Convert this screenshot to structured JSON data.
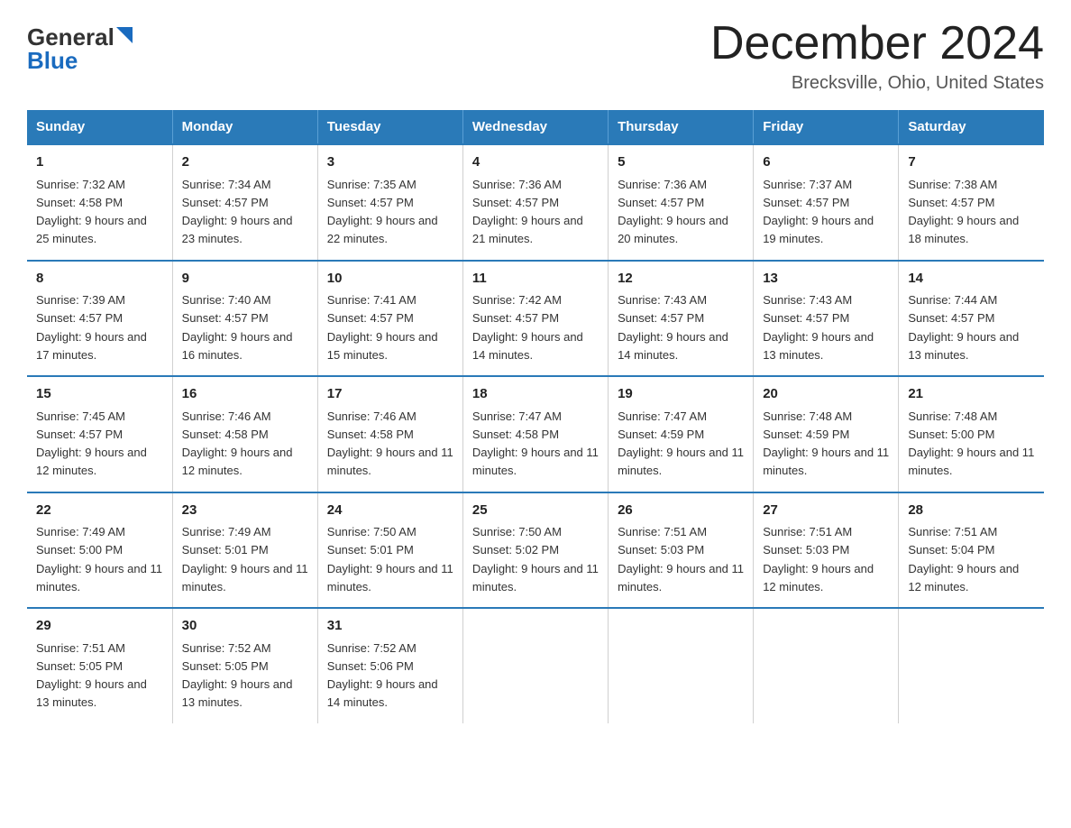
{
  "logo": {
    "general": "General",
    "blue": "Blue"
  },
  "title": "December 2024",
  "subtitle": "Brecksville, Ohio, United States",
  "header": {
    "days": [
      "Sunday",
      "Monday",
      "Tuesday",
      "Wednesday",
      "Thursday",
      "Friday",
      "Saturday"
    ]
  },
  "weeks": [
    [
      {
        "num": "1",
        "sunrise": "7:32 AM",
        "sunset": "4:58 PM",
        "daylight": "9 hours and 25 minutes"
      },
      {
        "num": "2",
        "sunrise": "7:34 AM",
        "sunset": "4:57 PM",
        "daylight": "9 hours and 23 minutes"
      },
      {
        "num": "3",
        "sunrise": "7:35 AM",
        "sunset": "4:57 PM",
        "daylight": "9 hours and 22 minutes"
      },
      {
        "num": "4",
        "sunrise": "7:36 AM",
        "sunset": "4:57 PM",
        "daylight": "9 hours and 21 minutes"
      },
      {
        "num": "5",
        "sunrise": "7:36 AM",
        "sunset": "4:57 PM",
        "daylight": "9 hours and 20 minutes"
      },
      {
        "num": "6",
        "sunrise": "7:37 AM",
        "sunset": "4:57 PM",
        "daylight": "9 hours and 19 minutes"
      },
      {
        "num": "7",
        "sunrise": "7:38 AM",
        "sunset": "4:57 PM",
        "daylight": "9 hours and 18 minutes"
      }
    ],
    [
      {
        "num": "8",
        "sunrise": "7:39 AM",
        "sunset": "4:57 PM",
        "daylight": "9 hours and 17 minutes"
      },
      {
        "num": "9",
        "sunrise": "7:40 AM",
        "sunset": "4:57 PM",
        "daylight": "9 hours and 16 minutes"
      },
      {
        "num": "10",
        "sunrise": "7:41 AM",
        "sunset": "4:57 PM",
        "daylight": "9 hours and 15 minutes"
      },
      {
        "num": "11",
        "sunrise": "7:42 AM",
        "sunset": "4:57 PM",
        "daylight": "9 hours and 14 minutes"
      },
      {
        "num": "12",
        "sunrise": "7:43 AM",
        "sunset": "4:57 PM",
        "daylight": "9 hours and 14 minutes"
      },
      {
        "num": "13",
        "sunrise": "7:43 AM",
        "sunset": "4:57 PM",
        "daylight": "9 hours and 13 minutes"
      },
      {
        "num": "14",
        "sunrise": "7:44 AM",
        "sunset": "4:57 PM",
        "daylight": "9 hours and 13 minutes"
      }
    ],
    [
      {
        "num": "15",
        "sunrise": "7:45 AM",
        "sunset": "4:57 PM",
        "daylight": "9 hours and 12 minutes"
      },
      {
        "num": "16",
        "sunrise": "7:46 AM",
        "sunset": "4:58 PM",
        "daylight": "9 hours and 12 minutes"
      },
      {
        "num": "17",
        "sunrise": "7:46 AM",
        "sunset": "4:58 PM",
        "daylight": "9 hours and 11 minutes"
      },
      {
        "num": "18",
        "sunrise": "7:47 AM",
        "sunset": "4:58 PM",
        "daylight": "9 hours and 11 minutes"
      },
      {
        "num": "19",
        "sunrise": "7:47 AM",
        "sunset": "4:59 PM",
        "daylight": "9 hours and 11 minutes"
      },
      {
        "num": "20",
        "sunrise": "7:48 AM",
        "sunset": "4:59 PM",
        "daylight": "9 hours and 11 minutes"
      },
      {
        "num": "21",
        "sunrise": "7:48 AM",
        "sunset": "5:00 PM",
        "daylight": "9 hours and 11 minutes"
      }
    ],
    [
      {
        "num": "22",
        "sunrise": "7:49 AM",
        "sunset": "5:00 PM",
        "daylight": "9 hours and 11 minutes"
      },
      {
        "num": "23",
        "sunrise": "7:49 AM",
        "sunset": "5:01 PM",
        "daylight": "9 hours and 11 minutes"
      },
      {
        "num": "24",
        "sunrise": "7:50 AM",
        "sunset": "5:01 PM",
        "daylight": "9 hours and 11 minutes"
      },
      {
        "num": "25",
        "sunrise": "7:50 AM",
        "sunset": "5:02 PM",
        "daylight": "9 hours and 11 minutes"
      },
      {
        "num": "26",
        "sunrise": "7:51 AM",
        "sunset": "5:03 PM",
        "daylight": "9 hours and 11 minutes"
      },
      {
        "num": "27",
        "sunrise": "7:51 AM",
        "sunset": "5:03 PM",
        "daylight": "9 hours and 12 minutes"
      },
      {
        "num": "28",
        "sunrise": "7:51 AM",
        "sunset": "5:04 PM",
        "daylight": "9 hours and 12 minutes"
      }
    ],
    [
      {
        "num": "29",
        "sunrise": "7:51 AM",
        "sunset": "5:05 PM",
        "daylight": "9 hours and 13 minutes"
      },
      {
        "num": "30",
        "sunrise": "7:52 AM",
        "sunset": "5:05 PM",
        "daylight": "9 hours and 13 minutes"
      },
      {
        "num": "31",
        "sunrise": "7:52 AM",
        "sunset": "5:06 PM",
        "daylight": "9 hours and 14 minutes"
      },
      null,
      null,
      null,
      null
    ]
  ]
}
